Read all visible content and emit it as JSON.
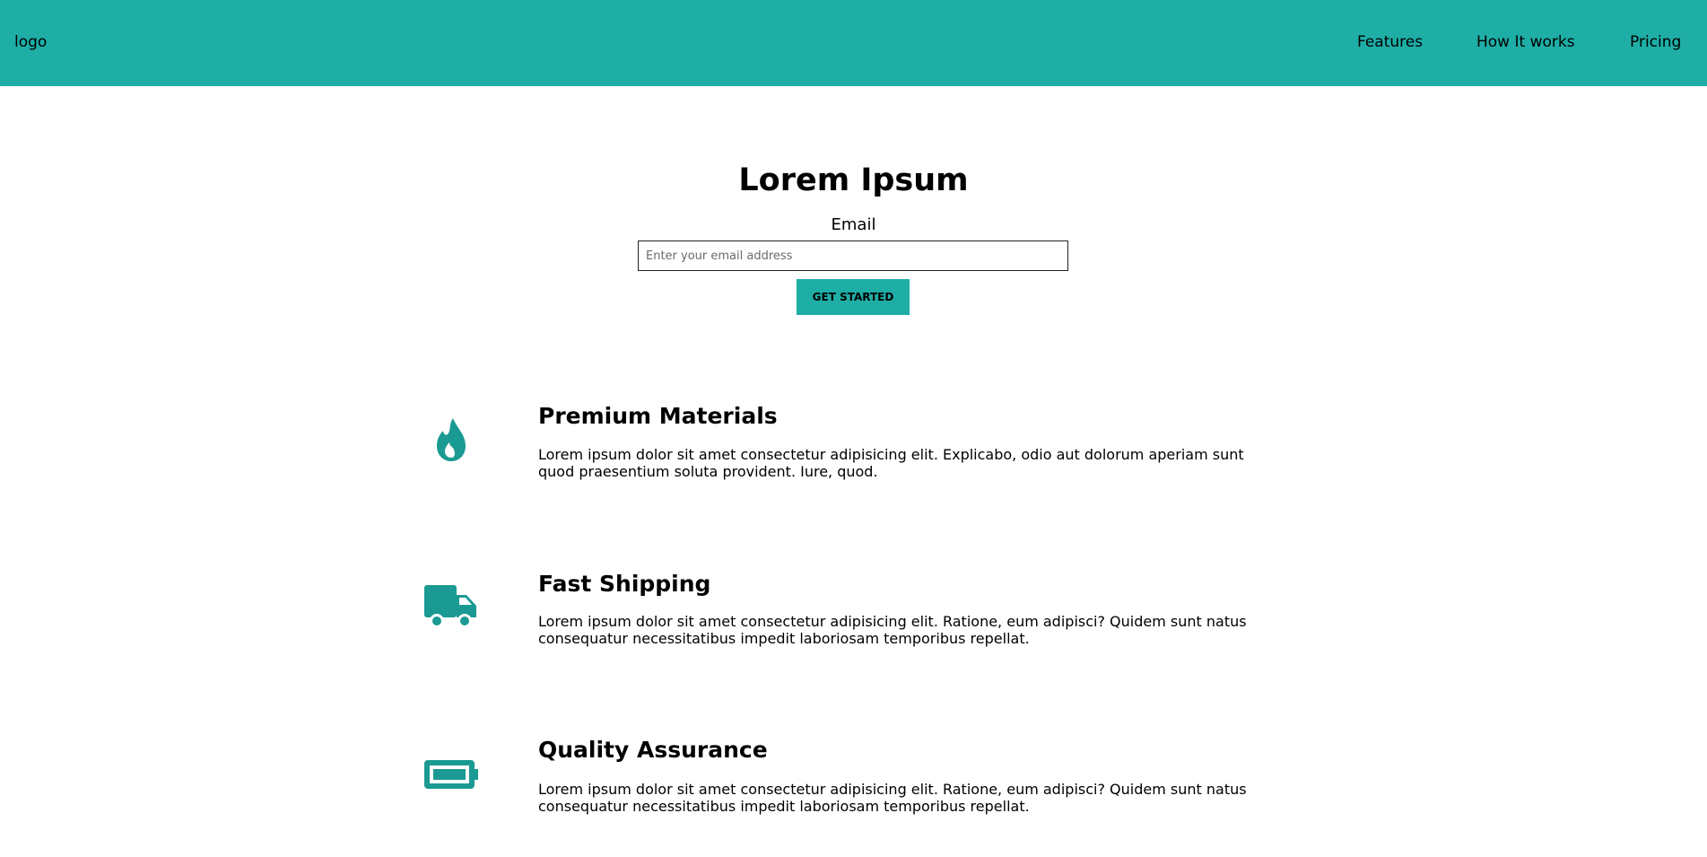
{
  "header": {
    "logo": "logo",
    "nav": [
      "Features",
      "How It works",
      "Pricing"
    ],
    "color": "#1eaea6"
  },
  "hero": {
    "title": "Lorem Ipsum",
    "email_label": "Email",
    "email_placeholder": "Enter your email address",
    "email_value": "",
    "cta_label": "GET STARTED"
  },
  "features": [
    {
      "icon": "fire-icon",
      "title": "Premium Materials",
      "desc": "Lorem ipsum dolor sit amet consectetur adipisicing elit. Explicabo, odio aut dolorum aperiam sunt quod praesentium soluta provident. Iure, quod."
    },
    {
      "icon": "truck-icon",
      "title": "Fast Shipping",
      "desc": "Lorem ipsum dolor sit amet consectetur adipisicing elit. Ratione, eum adipisci? Quidem sunt natus consequatur necessitatibus impedit laboriosam temporibus repellat."
    },
    {
      "icon": "battery-icon",
      "title": "Quality Assurance",
      "desc": "Lorem ipsum dolor sit amet consectetur adipisicing elit. Ratione, eum adipisci? Quidem sunt natus consequatur necessitatibus impedit laboriosam temporibus repellat."
    }
  ],
  "icon_color": "#1a9a92"
}
